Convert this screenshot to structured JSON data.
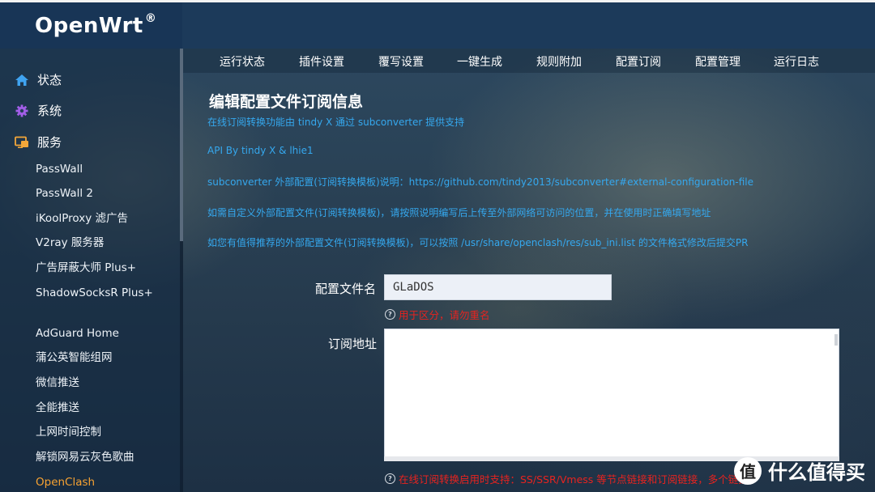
{
  "brand": {
    "name": "OpenWrt",
    "mark": "®"
  },
  "sidebar": {
    "top_items": [
      {
        "label": "状态",
        "icon": "home-icon"
      },
      {
        "label": "系统",
        "icon": "gear-icon"
      },
      {
        "label": "服务",
        "icon": "services-icon"
      }
    ],
    "services": [
      "PassWall",
      "PassWall 2",
      "iKoolProxy 滤广告",
      "V2ray 服务器",
      "广告屏蔽大师 Plus+",
      "ShadowSocksR Plus+",
      "AdGuard Home",
      "蒲公英智能组网",
      "微信推送",
      "全能推送",
      "上网时间控制",
      "解锁网易云灰色歌曲",
      "OpenClash"
    ],
    "active": "OpenClash"
  },
  "tabs": [
    "运行状态",
    "插件设置",
    "覆写设置",
    "一键生成",
    "规则附加",
    "配置订阅",
    "配置管理",
    "运行日志"
  ],
  "page": {
    "title": "编辑配置文件订阅信息",
    "info_lines": [
      "在线订阅转换功能由 tindy X 通过 subconverter 提供支持",
      "API By tindy X & lhie1",
      "subconverter 外部配置(订阅转换模板)说明：https://github.com/tindy2013/subconverter#external-configuration-file",
      "如需自定义外部配置文件(订阅转换模板)，请按照说明编写后上传至外部网络可访问的位置，并在使用时正确填写地址",
      "如您有值得推荐的外部配置文件(订阅转换模板)，可以按照 /usr/share/openclash/res/sub_ini.list 的文件格式修改后提交PR"
    ]
  },
  "form": {
    "name_label": "配置文件名",
    "name_value": "GLaDOS",
    "name_hint": "用于区分，请勿重名",
    "url_label": "订阅地址",
    "url_value": "",
    "url_hint": "在线订阅转换启用时支持：SS/SSR/Vmess 等节点链接和订阅链接，多个链接"
  },
  "watermark": {
    "symbol": "值",
    "text": "什么值得买"
  },
  "colors": {
    "header": "#1c3a5a",
    "info_text": "#35a8ee",
    "hint_text": "#e8231f",
    "active_item": "#f7a232"
  }
}
